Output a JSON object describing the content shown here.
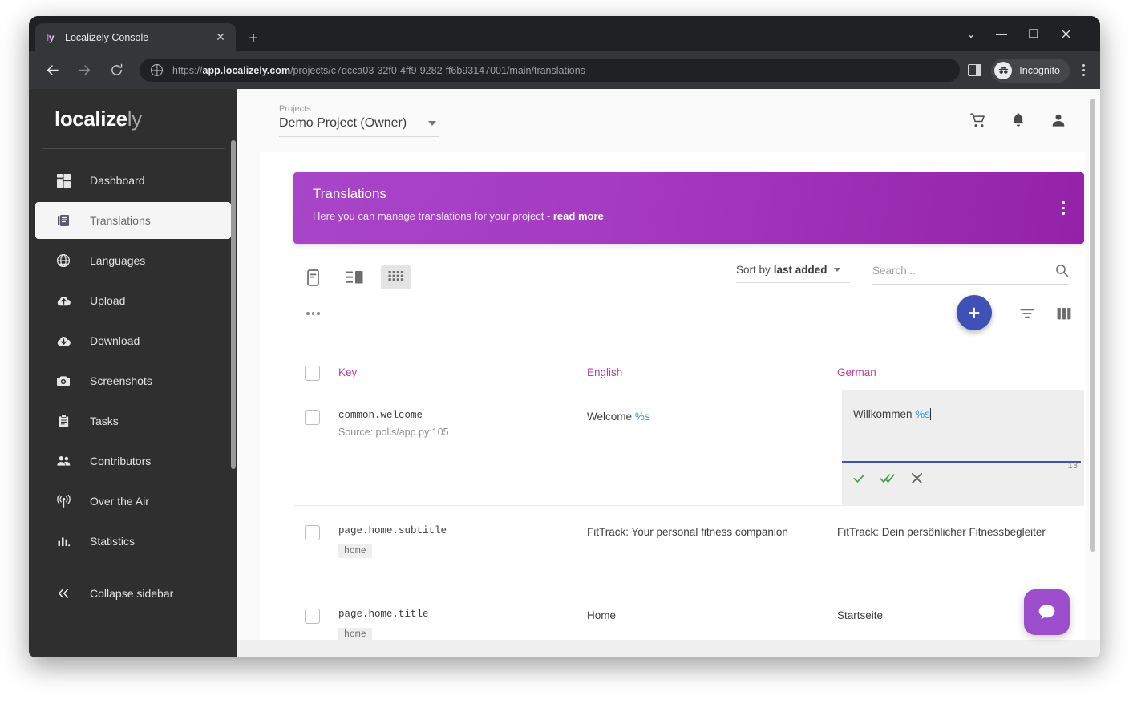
{
  "browser": {
    "tab_title": "Localizely Console",
    "favicon_text": "ly",
    "close_tab": "✕",
    "new_tab": "+",
    "url_prefix": "https://",
    "url_host": "app.localizely.com",
    "url_path": "/projects/c7dcca03-32f0-4ff9-9282-ff6b93147001/main/translations",
    "profile_label": "Incognito",
    "window_controls": {
      "expand": "⌄",
      "minimize": "—",
      "maximize": "▢",
      "close": "✕"
    }
  },
  "sidebar": {
    "logo_bold": "localize",
    "logo_light": "ly",
    "items": [
      {
        "label": "Dashboard",
        "icon": "dashboard-icon",
        "active": false
      },
      {
        "label": "Translations",
        "icon": "translations-icon",
        "active": true
      },
      {
        "label": "Languages",
        "icon": "globe-icon",
        "active": false
      },
      {
        "label": "Upload",
        "icon": "upload-cloud-icon",
        "active": false
      },
      {
        "label": "Download",
        "icon": "download-cloud-icon",
        "active": false
      },
      {
        "label": "Screenshots",
        "icon": "camera-icon",
        "active": false
      },
      {
        "label": "Tasks",
        "icon": "clipboard-icon",
        "active": false
      },
      {
        "label": "Contributors",
        "icon": "people-icon",
        "active": false
      },
      {
        "label": "Over the Air",
        "icon": "broadcast-icon",
        "active": false
      },
      {
        "label": "Statistics",
        "icon": "bar-chart-icon",
        "active": false
      }
    ],
    "collapse_label": "Collapse sidebar"
  },
  "header": {
    "project_label": "Projects",
    "project_value": "Demo Project (Owner)",
    "icons": [
      "cart-icon",
      "bell-icon",
      "account-icon"
    ]
  },
  "banner": {
    "title": "Translations",
    "subtitle": "Here you can manage translations for your project - ",
    "read_more": "read more",
    "accent_from": "#a845c8",
    "accent_to": "#9322a8"
  },
  "toolbar": {
    "views": [
      {
        "name": "document-view-icon",
        "active": false
      },
      {
        "name": "split-list-view-icon",
        "active": false
      },
      {
        "name": "grid-view-icon",
        "active": true
      }
    ],
    "sort_prefix": "Sort by",
    "sort_value": "last added",
    "search_placeholder": "Search...",
    "search_value": "",
    "add_label": "+",
    "accent_blue": "#3f51b5"
  },
  "table": {
    "columns": [
      "Key",
      "English",
      "German"
    ],
    "rows": [
      {
        "key": "common.welcome",
        "source": "Source: polls/app.py:105",
        "tag": "",
        "english_prefix": "Welcome ",
        "english_placeholder": "%s",
        "german_prefix": "Willkommen ",
        "german_placeholder": "%s",
        "editing": true,
        "char_count": "13"
      },
      {
        "key": "page.home.subtitle",
        "source": "",
        "tag": "home",
        "english_prefix": "FitTrack: Your personal fitness companion",
        "english_placeholder": "",
        "german_prefix": "FitTrack: Dein persönlicher Fitnessbegleiter",
        "german_placeholder": "",
        "editing": false,
        "char_count": ""
      },
      {
        "key": "page.home.title",
        "source": "",
        "tag": "home",
        "english_prefix": "Home",
        "english_placeholder": "",
        "german_prefix": "Startseite",
        "german_placeholder": "",
        "editing": false,
        "char_count": ""
      }
    ]
  },
  "chat": {
    "icon": "chat-bubble-icon",
    "color": "#9c4dcc"
  }
}
